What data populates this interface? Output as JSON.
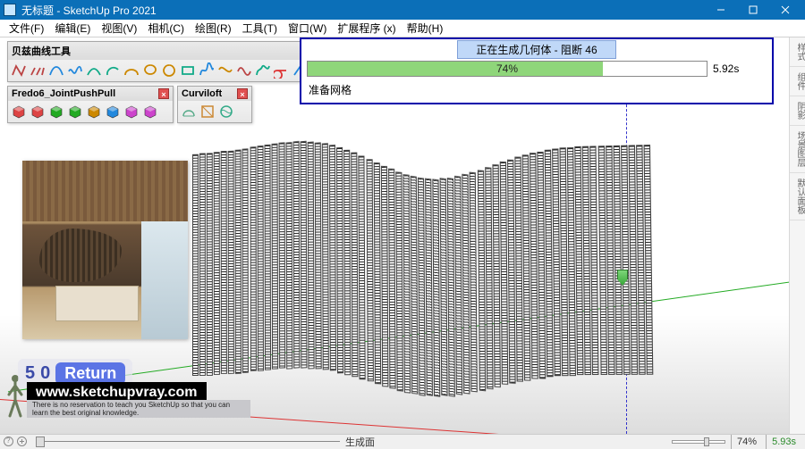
{
  "window": {
    "title": "无标题 - SketchUp Pro 2021"
  },
  "menu": {
    "items": [
      {
        "label": "文件(F)"
      },
      {
        "label": "编辑(E)"
      },
      {
        "label": "视图(V)"
      },
      {
        "label": "相机(C)"
      },
      {
        "label": "绘图(R)"
      },
      {
        "label": "工具(T)"
      },
      {
        "label": "窗口(W)"
      },
      {
        "label": "扩展程序 (x)"
      },
      {
        "label": "帮助(H)"
      }
    ]
  },
  "side_tabs": [
    "样式",
    "组件",
    "阴影",
    "场景图层",
    "默认面板"
  ],
  "bezier_toolbar": {
    "title": "贝兹曲线工具",
    "icons": [
      "polyline",
      "guidelines",
      "bezier-classic",
      "bspline",
      "nurbs",
      "arc",
      "fillet",
      "ellipse",
      "circle",
      "rectangle",
      "helix",
      "catmull",
      "wave",
      "freehand",
      "loop",
      "edit",
      "revert",
      "smooth",
      "settings",
      "wrench",
      "color",
      "heart"
    ]
  },
  "jointpush_toolbar": {
    "title": "Fredo6_JointPushPull",
    "icons": [
      "joint",
      "round",
      "vector",
      "normal",
      "extrude",
      "follow",
      "redo",
      "undo"
    ]
  },
  "curviloft_toolbar": {
    "title": "Curviloft",
    "icons": [
      "loft",
      "skin",
      "spline"
    ]
  },
  "progress": {
    "header": "正在生成几何体 - 阻断 46",
    "percent_label": "74%",
    "percent_value": 74,
    "elapsed": "5.92s",
    "status": "准备网格"
  },
  "counter": {
    "a": "5",
    "b": "0",
    "return_label": "Return"
  },
  "watermark": {
    "url": "www.sketchupvray.com",
    "sub": "There is no reservation to teach you SketchUp so that you can learn the best original knowledge."
  },
  "statusbar": {
    "center": "生成面",
    "percent": "74%",
    "time": "5.93s"
  }
}
